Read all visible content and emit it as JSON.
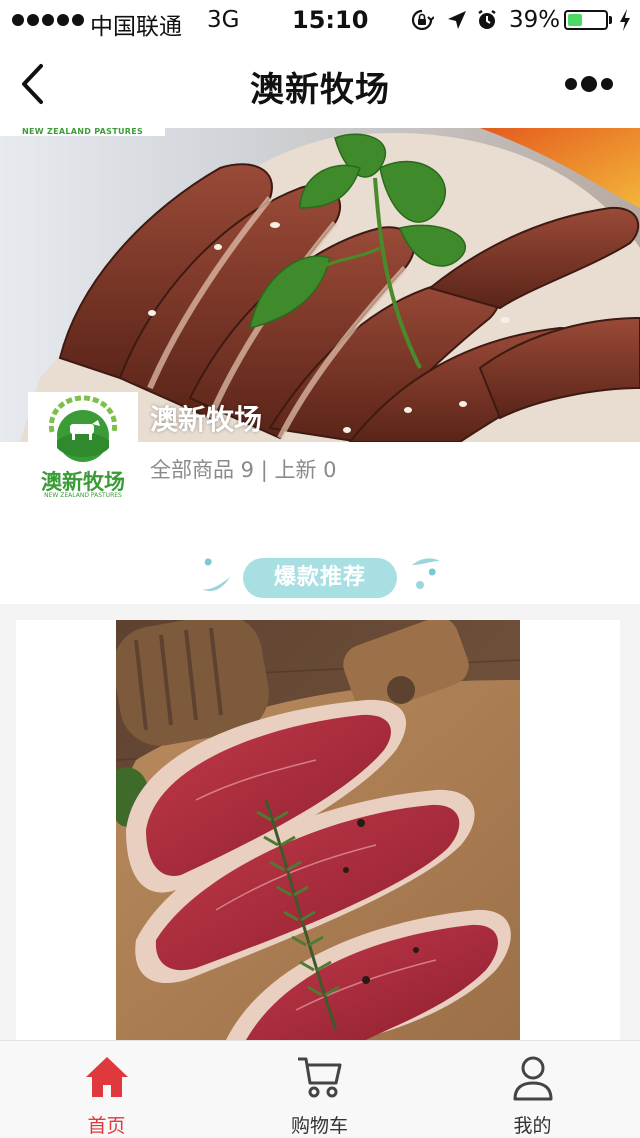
{
  "status_bar": {
    "carrier": "中国联通",
    "network": "3G",
    "time": "15:10",
    "battery_percent": "39%",
    "battery_level": 0.39,
    "icons": [
      "signal-dots-icon",
      "rotation-lock-icon",
      "location-arrow-icon",
      "alarm-icon",
      "battery-icon",
      "charging-bolt-icon"
    ]
  },
  "nav": {
    "title": "澳新牧场",
    "back_icon": "back-chevron-icon",
    "more_icon": "more-dots-icon"
  },
  "banner": {
    "strip_text": "NEW ZEALAND PASTURES",
    "image": "sliced-braised-beef-with-parsley"
  },
  "shop": {
    "logo_text": "澳新牧场",
    "logo_subtext": "NEW ZEALAND PASTURES",
    "name": "澳新牧场",
    "stats": "全部商品 9 | 上新 0"
  },
  "section": {
    "title": "爆款推荐"
  },
  "product": {
    "image": "raw-beef-steaks-with-rosemary"
  },
  "tabs": [
    {
      "label": "首页",
      "icon": "home-icon",
      "active": true
    },
    {
      "label": "购物车",
      "icon": "cart-icon",
      "active": false
    },
    {
      "label": "我的",
      "icon": "user-icon",
      "active": false
    }
  ],
  "colors": {
    "accent_red": "#e0393d",
    "brand_green": "#3b9b37",
    "section_pill": "#a8dfe3",
    "battery_green": "#4cd964"
  }
}
